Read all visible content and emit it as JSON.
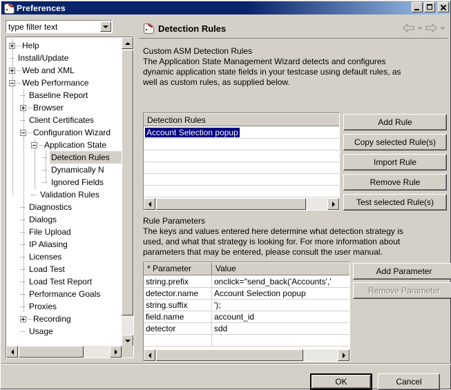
{
  "window": {
    "title": "Preferences",
    "icon": "gauge-icon",
    "controls": {
      "minimize": "Minimize",
      "maximize": "Maximize",
      "close": "Close"
    }
  },
  "filter": {
    "value": "type filter text",
    "placeholder": "type filter text",
    "dropdown_icon": "chevron-down-icon"
  },
  "tree": {
    "items": [
      {
        "label": "Help",
        "indent": 0,
        "state": "collapsed",
        "selected": false
      },
      {
        "label": "Install/Update",
        "indent": 0,
        "state": "leaf",
        "selected": false
      },
      {
        "label": "Web and XML",
        "indent": 0,
        "state": "collapsed",
        "selected": false
      },
      {
        "label": "Web Performance",
        "indent": 0,
        "state": "expanded",
        "selected": false
      },
      {
        "label": "Baseline Report",
        "indent": 1,
        "state": "leaf",
        "selected": false
      },
      {
        "label": "Browser",
        "indent": 1,
        "state": "collapsed",
        "selected": false
      },
      {
        "label": "Client Certificates",
        "indent": 1,
        "state": "leaf",
        "selected": false
      },
      {
        "label": "Configuration Wizard",
        "indent": 1,
        "state": "expanded",
        "selected": false
      },
      {
        "label": "Application State",
        "indent": 2,
        "state": "expanded",
        "selected": false
      },
      {
        "label": "Detection Rules",
        "indent": 3,
        "state": "leaf",
        "selected": true
      },
      {
        "label": "Dynamically N",
        "indent": 3,
        "state": "leaf",
        "selected": false
      },
      {
        "label": "Ignored Fields",
        "indent": 3,
        "state": "leaf",
        "selected": false
      },
      {
        "label": "Validation Rules",
        "indent": 2,
        "state": "leaf",
        "selected": false
      },
      {
        "label": "Diagnostics",
        "indent": 1,
        "state": "leaf",
        "selected": false
      },
      {
        "label": "Dialogs",
        "indent": 1,
        "state": "leaf",
        "selected": false
      },
      {
        "label": "File Upload",
        "indent": 1,
        "state": "leaf",
        "selected": false
      },
      {
        "label": "IP Aliasing",
        "indent": 1,
        "state": "leaf",
        "selected": false
      },
      {
        "label": "Licenses",
        "indent": 1,
        "state": "leaf",
        "selected": false
      },
      {
        "label": "Load Test",
        "indent": 1,
        "state": "leaf",
        "selected": false
      },
      {
        "label": "Load Test Report",
        "indent": 1,
        "state": "leaf",
        "selected": false
      },
      {
        "label": "Performance Goals",
        "indent": 1,
        "state": "leaf",
        "selected": false
      },
      {
        "label": "Proxies",
        "indent": 1,
        "state": "leaf",
        "selected": false
      },
      {
        "label": "Recording",
        "indent": 1,
        "state": "collapsed",
        "selected": false
      },
      {
        "label": "Usage",
        "indent": 1,
        "state": "leaf",
        "selected": false
      }
    ]
  },
  "page": {
    "icon": "gauge-icon",
    "title": "Detection Rules",
    "nav": {
      "back_icon": "arrow-left-icon",
      "back_menu_icon": "chevron-down-icon",
      "forward_icon": "arrow-right-icon",
      "forward_menu_icon": "chevron-down-icon"
    },
    "description": [
      "Custom ASM Detection Rules",
      "The Application State Management Wizard detects and configures",
      "dynamic application state fields in your testcase using default rules, as",
      "well as custom rules, as supplied below."
    ]
  },
  "rules_list": {
    "column_header": "Detection Rules",
    "rows": [
      "Account Selection popup",
      "",
      "",
      "",
      "",
      ""
    ],
    "selected_index": 0,
    "scroll": {
      "left_icon": "arrow-left-icon",
      "right_icon": "arrow-right-icon"
    }
  },
  "rule_buttons": [
    {
      "label": "Add Rule",
      "enabled": true
    },
    {
      "label": "Copy selected Rule(s)",
      "enabled": true
    },
    {
      "label": "Import Rule",
      "enabled": true
    },
    {
      "label": "Remove Rule",
      "enabled": true
    },
    {
      "label": "Test selected Rule(s)",
      "enabled": true
    }
  ],
  "parameters": {
    "title": "Rule Parameters",
    "description": [
      "The keys and values entered here determine what detection strategy is",
      "used, and what that strategy is looking for. For more information about",
      "parameters that may be entered, please consult the user manual."
    ],
    "columns": [
      "* Parameter",
      "Value"
    ],
    "rows": [
      {
        "parameter": "string.prefix",
        "value": "onclick=\"send_back('Accounts',' "
      },
      {
        "parameter": "detector.name",
        "value": "Account Selection popup"
      },
      {
        "parameter": "string.suffix",
        "value": "');"
      },
      {
        "parameter": "field.name",
        "value": "account_id"
      },
      {
        "parameter": "detector",
        "value": "sdd"
      },
      {
        "parameter": "",
        "value": ""
      }
    ],
    "scroll": {
      "left_icon": "arrow-left-icon",
      "right_icon": "arrow-right-icon"
    }
  },
  "param_buttons": [
    {
      "label": "Add Parameter",
      "enabled": true
    },
    {
      "label": "Remove Parameter",
      "enabled": false
    }
  ],
  "dialog_buttons": {
    "ok": "OK",
    "cancel": "Cancel"
  },
  "colors": {
    "face": "#d4d0c8",
    "selection": "#000080",
    "title_bar": "#0a246a",
    "disabled_text": "#808080"
  }
}
